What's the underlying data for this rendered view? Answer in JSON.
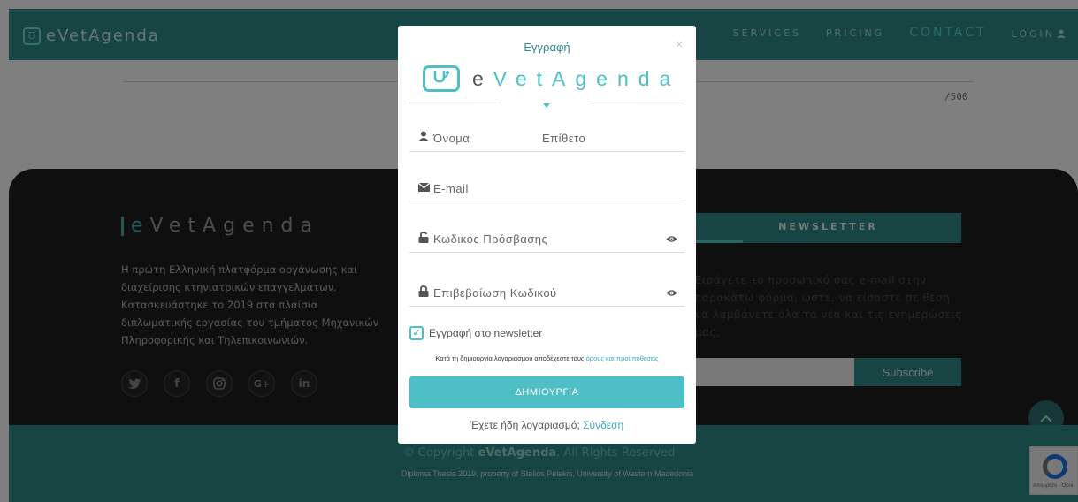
{
  "nav": {
    "logo_glyph": "Ʊ",
    "brand": "eVetAgenda",
    "links": [
      "SERVICES",
      "PRICING",
      "CONTACT",
      "LOGIN"
    ],
    "active": "CONTACT"
  },
  "page": {
    "counter": "/500"
  },
  "footer": {
    "brand_e": "e",
    "brand_rest": "VetAgenda",
    "description": "Η πρώτη Ελληνική πλατφόρμα οργάνωσης και διαχείρισης κτηνιατρικών επαγγελμάτων. Κατασκευάστηκε το 2019 στα πλαίσια διπλωματικής εργασίας του τμήματος Μηχανικών Πληροφορικής και Τηλεπικοινωνιών.",
    "social": [
      "twitter-icon",
      "facebook-icon",
      "instagram-icon",
      "google-plus-icon",
      "linkedin-icon"
    ],
    "newsletter_title": "NEWSLETTER",
    "newsletter_text": "Εισάγετε το προσωπικό σας e-mail στην παρακάτω φόρμα, ώστε, να είσαστε σε θέση να λαμβάνετε όλα τα νέα και τις ενημερώσεις μας.",
    "subscribe": "Subscribe",
    "copyright_pre": "© Copyright ",
    "copyright_e": "e",
    "copyright_brand": "VetAgenda",
    "copyright_post": ". All Rights Reserved",
    "thesis": "Diploma Thesis 2019, property of Stelios Pelekis, University of Western Macedonia",
    "recaptcha": "Απόρρητο - Όροι"
  },
  "modal": {
    "title": "Εγγραφή",
    "close": "×",
    "logo_e": "e",
    "logo_rest": "VetAgenda",
    "first_name_ph": "Όνομα",
    "last_name_ph": "Επίθετο",
    "email_ph": "E-mail",
    "password_ph": "Κωδικός Πρόσβασης",
    "confirm_ph": "Επιβεβαίωση Κωδικού",
    "newsletter_checkbox": "Εγγραφή στο newsletter",
    "newsletter_checked": true,
    "terms_pre": "Κατά τη δημιουργία λογαριασμού αποδέχεστε τους ",
    "terms_link": "όρους και προϋποθέσεις",
    "create_button": "ΔΗΜΙΟΥΡΓΙΑ",
    "have_account": "Έχετε ήδη λογαριασμό; ",
    "login_link": "Σύνδεση"
  },
  "colors": {
    "accent": "#2e8a86",
    "modal_accent": "#4fbfc6",
    "footer_bg": "#1e1e1e"
  }
}
